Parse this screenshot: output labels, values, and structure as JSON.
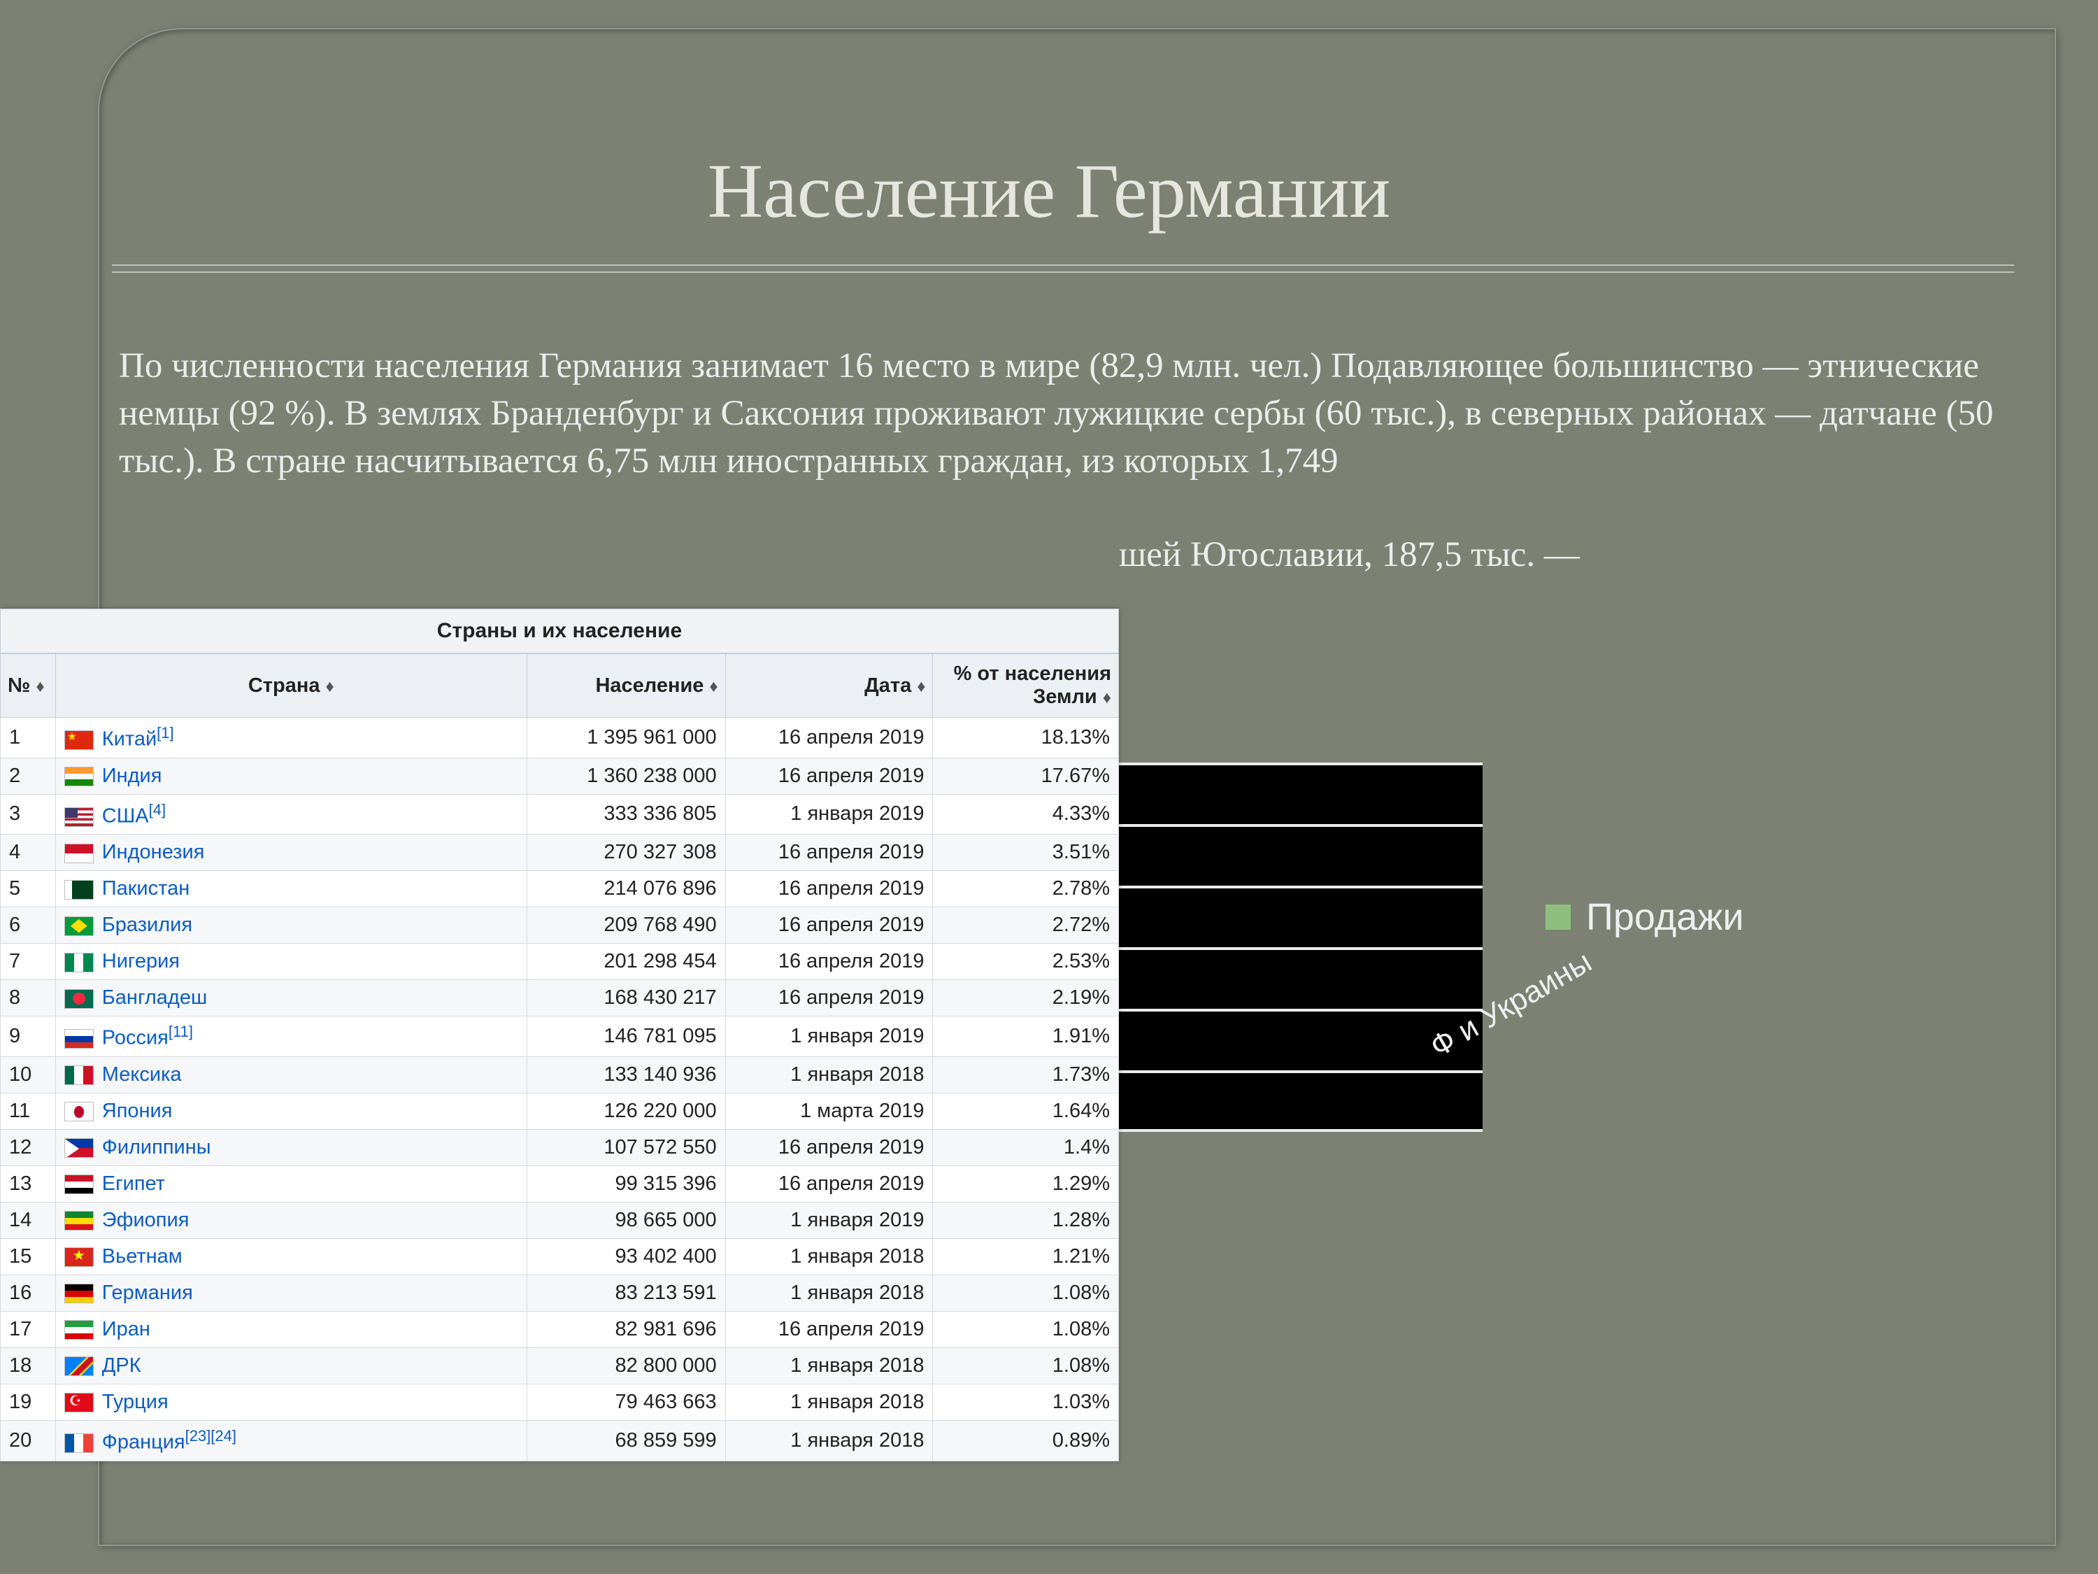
{
  "title": "Население Германии",
  "body_text": "По численности населения Германия занимает 16 место в мире (82,9 млн. чел.) Подавляющее большинство — этнические немцы (92 %). В землях Бранденбург и Саксония проживают лужицкие сербы (60 тыс.), в северных районах — датчане (50 тыс.). В стране насчитывается 6,75 млн иностранных граждан, из которых 1,749",
  "body_text_right": "шей Югославии, 187,5 тыс. —",
  "legend": {
    "label": "Продажи"
  },
  "axis_label": "Ф и Украины",
  "table": {
    "caption": "Страны и их население",
    "headers": {
      "num": "№",
      "country": "Страна",
      "population": "Население",
      "date": "Дата",
      "pct": "% от населения Земли"
    },
    "rows": [
      {
        "n": "1",
        "flag": "cn",
        "country": "Китай",
        "ref": "[1]",
        "pop": "1 395 961 000",
        "date": "16 апреля 2019",
        "pct": "18.13%"
      },
      {
        "n": "2",
        "flag": "in",
        "country": "Индия",
        "ref": "",
        "pop": "1 360 238 000",
        "date": "16 апреля 2019",
        "pct": "17.67%"
      },
      {
        "n": "3",
        "flag": "us",
        "country": "США",
        "ref": "[4]",
        "pop": "333 336 805",
        "date": "1 января 2019",
        "pct": "4.33%"
      },
      {
        "n": "4",
        "flag": "id",
        "country": "Индонезия",
        "ref": "",
        "pop": "270 327 308",
        "date": "16 апреля 2019",
        "pct": "3.51%"
      },
      {
        "n": "5",
        "flag": "pk",
        "country": "Пакистан",
        "ref": "",
        "pop": "214 076 896",
        "date": "16 апреля 2019",
        "pct": "2.78%"
      },
      {
        "n": "6",
        "flag": "br",
        "country": "Бразилия",
        "ref": "",
        "pop": "209 768 490",
        "date": "16 апреля 2019",
        "pct": "2.72%"
      },
      {
        "n": "7",
        "flag": "ng",
        "country": "Нигерия",
        "ref": "",
        "pop": "201 298 454",
        "date": "16 апреля 2019",
        "pct": "2.53%"
      },
      {
        "n": "8",
        "flag": "bd",
        "country": "Бангладеш",
        "ref": "",
        "pop": "168 430 217",
        "date": "16 апреля 2019",
        "pct": "2.19%"
      },
      {
        "n": "9",
        "flag": "ru",
        "country": "Россия",
        "ref": "[11]",
        "pop": "146 781 095",
        "date": "1 января 2019",
        "pct": "1.91%"
      },
      {
        "n": "10",
        "flag": "mx",
        "country": "Мексика",
        "ref": "",
        "pop": "133 140 936",
        "date": "1 января 2018",
        "pct": "1.73%"
      },
      {
        "n": "11",
        "flag": "jp",
        "country": "Япония",
        "ref": "",
        "pop": "126 220 000",
        "date": "1 марта 2019",
        "pct": "1.64%"
      },
      {
        "n": "12",
        "flag": "ph",
        "country": "Филиппины",
        "ref": "",
        "pop": "107 572 550",
        "date": "16 апреля 2019",
        "pct": "1.4%"
      },
      {
        "n": "13",
        "flag": "eg",
        "country": "Египет",
        "ref": "",
        "pop": "99 315 396",
        "date": "16 апреля 2019",
        "pct": "1.29%"
      },
      {
        "n": "14",
        "flag": "et",
        "country": "Эфиопия",
        "ref": "",
        "pop": "98 665 000",
        "date": "1 января 2019",
        "pct": "1.28%"
      },
      {
        "n": "15",
        "flag": "vn",
        "country": "Вьетнам",
        "ref": "",
        "pop": "93 402 400",
        "date": "1 января 2018",
        "pct": "1.21%"
      },
      {
        "n": "16",
        "flag": "de",
        "country": "Германия",
        "ref": "",
        "pop": "83 213 591",
        "date": "1 января 2018",
        "pct": "1.08%"
      },
      {
        "n": "17",
        "flag": "ir",
        "country": "Иран",
        "ref": "",
        "pop": "82 981 696",
        "date": "16 апреля 2019",
        "pct": "1.08%"
      },
      {
        "n": "18",
        "flag": "cd",
        "country": "ДРК",
        "ref": "",
        "pop": "82 800 000",
        "date": "1 января 2018",
        "pct": "1.08%"
      },
      {
        "n": "19",
        "flag": "tr",
        "country": "Турция",
        "ref": "",
        "pop": "79 463 663",
        "date": "1 января 2018",
        "pct": "1.03%"
      },
      {
        "n": "20",
        "flag": "fr",
        "country": "Франция",
        "ref": "[23][24]",
        "pop": "68 859 599",
        "date": "1 января 2018",
        "pct": "0.89%"
      }
    ]
  },
  "chart_data": {
    "type": "bar",
    "orientation": "horizontal",
    "title": "",
    "series": [
      {
        "name": "Продажи",
        "values": [
          1,
          1,
          1,
          1,
          1,
          1
        ]
      }
    ],
    "categories": [
      "",
      "",
      "",
      "",
      "",
      ""
    ],
    "note": "Bar values are not labeled in the source image; equal-width placeholder bars shown behind the overlaid table.",
    "xlabel": "Ф и Украины"
  }
}
